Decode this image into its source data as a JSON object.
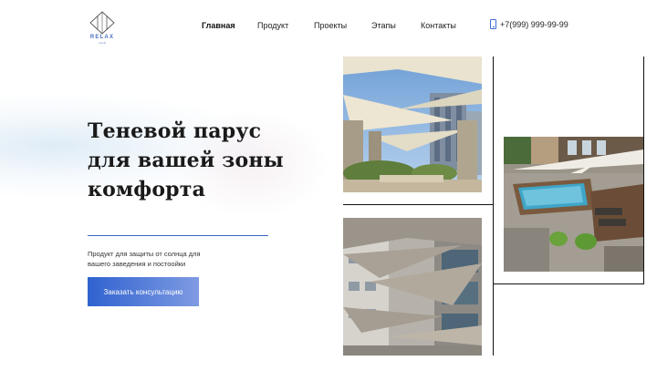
{
  "logo": {
    "text": "RELAX",
    "sub": "твой"
  },
  "nav": {
    "items": [
      {
        "label": "Главная",
        "active": true
      },
      {
        "label": "Продукт",
        "active": false
      },
      {
        "label": "Проекты",
        "active": false
      },
      {
        "label": "Этапы",
        "active": false
      },
      {
        "label": "Контакты",
        "active": false
      }
    ]
  },
  "phone": {
    "number": "+7(999) 999-99-99",
    "icon": "phone-icon"
  },
  "hero": {
    "title_lines": [
      "Теневой парус",
      "для вашей зоны",
      "комфорта"
    ],
    "subtitle_lines": [
      "Продукт для защиты от солнца для",
      "вашего заведения и постоойки"
    ],
    "cta_label": "Заказать консультацию"
  },
  "colors": {
    "accent": "#3a6fd8",
    "button_start": "#2f62cf",
    "button_end": "#7f9be2"
  },
  "gallery": {
    "photos": [
      {
        "subject": "shade sails over courtyard with stone columns"
      },
      {
        "subject": "shade sails over pool deck"
      },
      {
        "subject": "shade sails between buildings"
      }
    ]
  }
}
